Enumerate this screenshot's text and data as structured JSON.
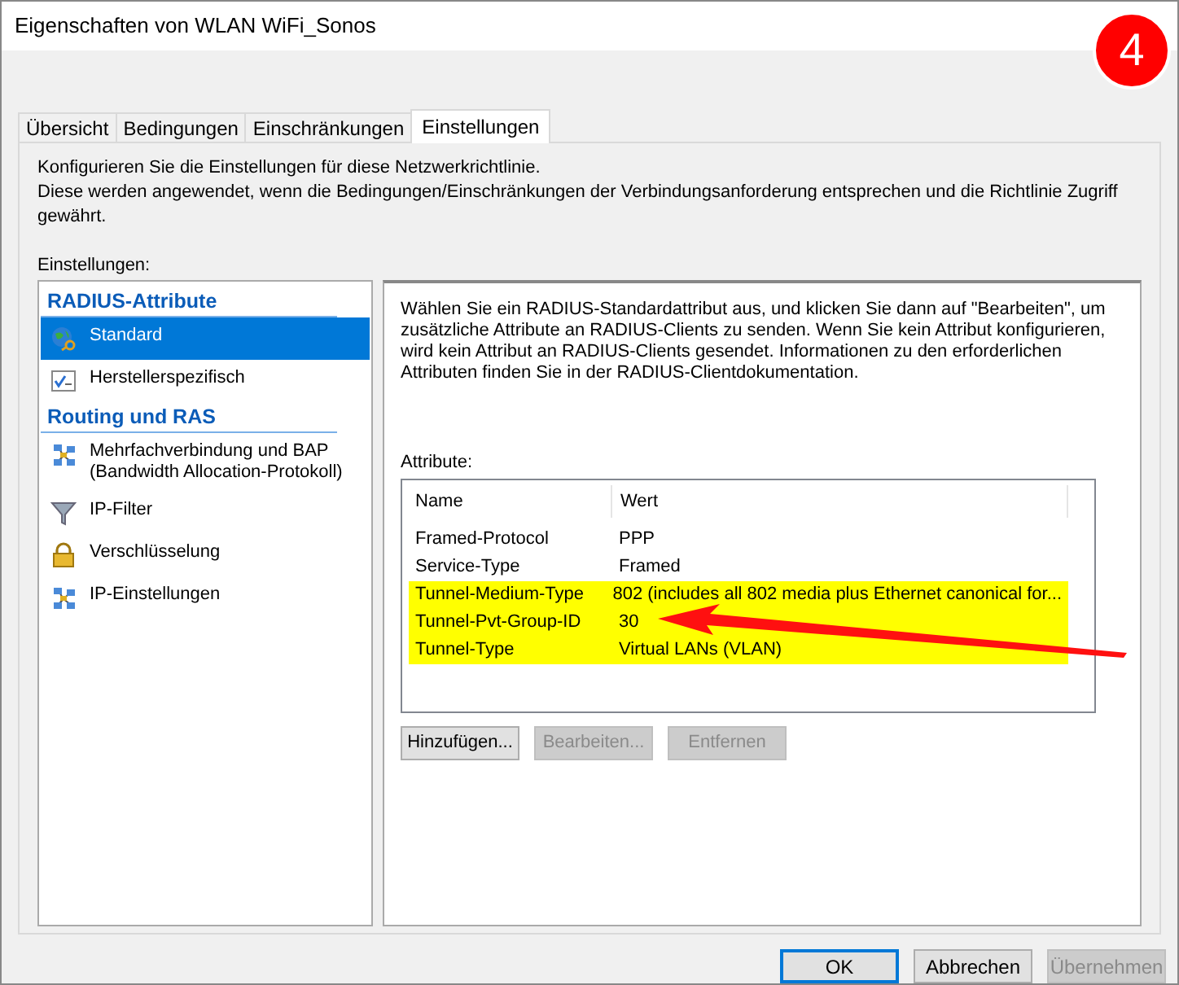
{
  "window": {
    "title": "Eigenschaften von WLAN WiFi_Sonos"
  },
  "badge": "4",
  "tabs": [
    {
      "label": "Übersicht",
      "selected": false
    },
    {
      "label": "Bedingungen",
      "selected": false
    },
    {
      "label": "Einschränkungen",
      "selected": false
    },
    {
      "label": "Einstellungen",
      "selected": true
    }
  ],
  "intro": [
    "Konfigurieren Sie die Einstellungen für diese Netzwerkrichtlinie.",
    "Diese werden angewendet, wenn die Bedingungen/Einschränkungen der Verbindungsanforderung entsprechen und die Richtlinie Zugriff gewährt."
  ],
  "settings_label": "Einstellungen:",
  "sidebar": {
    "groups": [
      {
        "title": "RADIUS-Attribute",
        "items": [
          {
            "label": "Standard",
            "selected": true
          },
          {
            "label": "Herstellerspezifisch",
            "selected": false
          }
        ]
      },
      {
        "title": "Routing und RAS",
        "items": [
          {
            "label": "Mehrfachverbindung und BAP (Bandwidth Allocation-Protokoll)",
            "selected": false
          },
          {
            "label": "IP-Filter",
            "selected": false
          },
          {
            "label": "Verschlüsselung",
            "selected": false
          },
          {
            "label": "IP-Einstellungen",
            "selected": false
          }
        ]
      }
    ]
  },
  "description": "Wählen Sie ein RADIUS-Standardattribut aus, und klicken Sie dann auf \"Bearbeiten\", um zusätzliche Attribute an RADIUS-Clients zu senden. Wenn Sie kein Attribut konfigurieren, wird kein Attribut an RADIUS-Clients gesendet. Informationen zu den erforderlichen Attributen finden Sie in der RADIUS-Clientdokumentation.",
  "attributes_label": "Attribute:",
  "table": {
    "columns": [
      "Name",
      "Wert"
    ],
    "rows": [
      {
        "name": "Framed-Protocol",
        "value": "PPP",
        "highlighted": false
      },
      {
        "name": "Service-Type",
        "value": "Framed",
        "highlighted": false
      },
      {
        "name": "Tunnel-Medium-Type",
        "value": "802 (includes all 802 media plus Ethernet canonical for...",
        "highlighted": true
      },
      {
        "name": "Tunnel-Pvt-Group-ID",
        "value": "30",
        "highlighted": true
      },
      {
        "name": "Tunnel-Type",
        "value": "Virtual LANs (VLAN)",
        "highlighted": true
      }
    ]
  },
  "table_buttons": [
    {
      "label": "Hinzufügen...",
      "disabled": false
    },
    {
      "label": "Bearbeiten...",
      "disabled": true
    },
    {
      "label": "Entfernen",
      "disabled": true
    }
  ],
  "dialog_buttons": [
    {
      "label": "OK",
      "disabled": false,
      "default": true
    },
    {
      "label": "Abbrechen",
      "disabled": false,
      "default": false
    },
    {
      "label": "Übernehmen",
      "disabled": true,
      "default": false
    }
  ]
}
